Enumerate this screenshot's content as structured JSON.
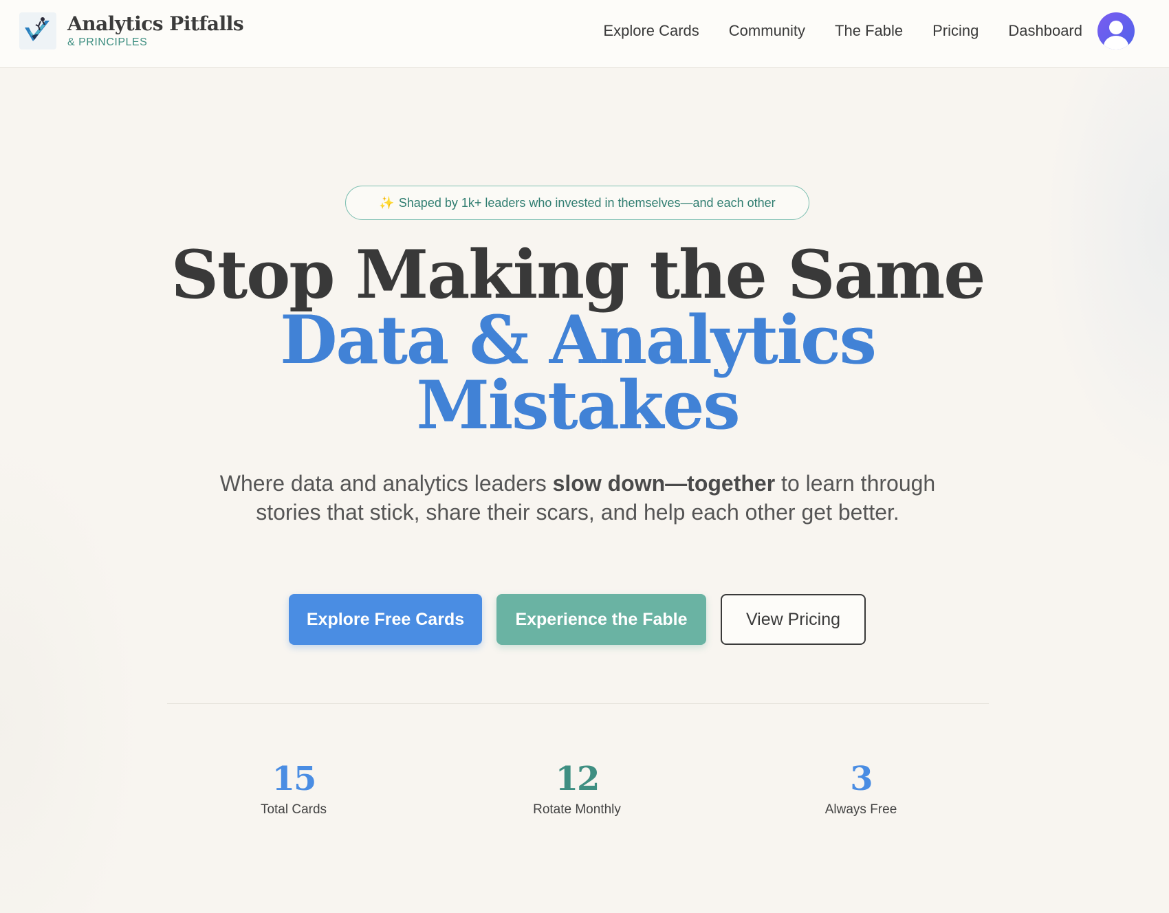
{
  "brand": {
    "title": "Analytics Pitfalls",
    "subtitle": "& PRINCIPLES",
    "logo_icon": "checkmark-climber-logo"
  },
  "nav": {
    "items": [
      "Explore Cards",
      "Community",
      "The Fable",
      "Pricing",
      "Dashboard"
    ],
    "avatar_icon": "user-avatar-icon"
  },
  "hero": {
    "badge_icon": "✨",
    "badge_text": "Shaped by 1k+ leaders who invested in themselves—and each other",
    "headline_line1": "Stop Making the Same",
    "headline_line2": "Data & Analytics",
    "headline_line3": "Mistakes",
    "sub_before": "Where data and analytics leaders ",
    "sub_bold": "slow down—together",
    "sub_after": " to learn through stories that stick, share their scars, and help each other get better."
  },
  "buttons": {
    "primary": "Explore Free Cards",
    "secondary": "Experience the Fable",
    "tertiary": "View Pricing"
  },
  "stats": [
    {
      "value": "15",
      "label": "Total Cards"
    },
    {
      "value": "12",
      "label": "Rotate Monthly"
    },
    {
      "value": "3",
      "label": "Always Free"
    }
  ],
  "colors": {
    "accent_blue": "#4a8de3",
    "accent_teal": "#6ab3a3",
    "brand_teal_text": "#3f8f82",
    "background": "#f8f5f0"
  }
}
